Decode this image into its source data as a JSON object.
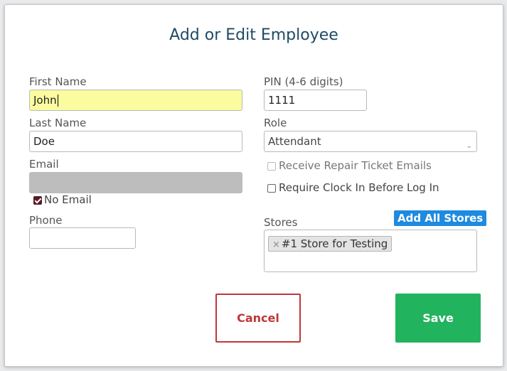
{
  "dialog": {
    "title": "Add or Edit Employee"
  },
  "first_name": {
    "label": "First Name",
    "value": "John"
  },
  "last_name": {
    "label": "Last Name",
    "value": "Doe"
  },
  "email": {
    "label": "Email",
    "value": ""
  },
  "no_email": {
    "label": "No Email",
    "checked": true
  },
  "phone": {
    "label": "Phone",
    "value": ""
  },
  "pin": {
    "label": "PIN (4-6 digits)",
    "value": "1111"
  },
  "role": {
    "label": "Role",
    "selected": "Attendant"
  },
  "receive_repair_emails": {
    "label": "Receive Repair Ticket Emails",
    "checked": false,
    "disabled": true
  },
  "require_clock_in": {
    "label": "Require Clock In Before Log In",
    "checked": false
  },
  "stores": {
    "label": "Stores",
    "add_all_label": "Add All Stores",
    "selected": [
      "#1 Store for Testing"
    ],
    "remove_glyph": "×"
  },
  "actions": {
    "cancel_label": "Cancel",
    "save_label": "Save"
  },
  "colors": {
    "title": "#1f4a64",
    "add_all": "#1e8ae0",
    "save": "#22b35e",
    "cancel": "#c0363a",
    "focus_bg": "#fbfb9f"
  }
}
